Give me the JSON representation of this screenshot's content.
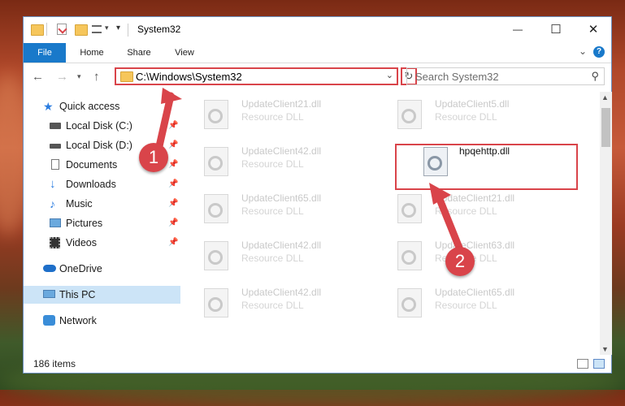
{
  "window": {
    "title": "System32",
    "controls": {
      "minimize": "—",
      "maximize": "☐",
      "close": "✕"
    }
  },
  "ribbon": {
    "tabs": [
      "File",
      "Home",
      "Share",
      "View"
    ],
    "help": "?"
  },
  "navbar": {
    "address": "C:\\Windows\\System32",
    "search_placeholder": "Search System32"
  },
  "sidebar": {
    "items": [
      {
        "label": "Quick access"
      },
      {
        "label": "Local Disk (C:)"
      },
      {
        "label": "Local Disk (D:)"
      },
      {
        "label": "Documents"
      },
      {
        "label": "Downloads"
      },
      {
        "label": "Music"
      },
      {
        "label": "Pictures"
      },
      {
        "label": "Videos"
      },
      {
        "label": "OneDrive"
      },
      {
        "label": "This PC"
      },
      {
        "label": "Network"
      }
    ]
  },
  "files": [
    {
      "name": "UpdateClient21.dll",
      "desc": "Resource DLL"
    },
    {
      "name": "UpdateClient5.dll",
      "desc": "Resource DLL"
    },
    {
      "name": "UpdateClient42.dll",
      "desc": "Resource DLL"
    },
    {
      "name": "hpqehttp.dll",
      "desc": ""
    },
    {
      "name": "UpdateClient65.dll",
      "desc": "Resource DLL"
    },
    {
      "name": "UpdateClient21.dll",
      "desc": "Resource DLL"
    },
    {
      "name": "UpdateClient42.dll",
      "desc": "Resource DLL"
    },
    {
      "name": "UpdateClient63.dll",
      "desc": "Resource DLL"
    },
    {
      "name": "UpdateClient42.dll",
      "desc": "Resource DLL"
    },
    {
      "name": "UpdateClient65.dll",
      "desc": "Resource DLL"
    }
  ],
  "status": {
    "items_count": "186 items"
  },
  "callouts": {
    "step1": "1",
    "step2": "2"
  },
  "colors": {
    "accent": "#1979ca",
    "highlight": "#d9444a",
    "selected": "#cce4f7"
  }
}
